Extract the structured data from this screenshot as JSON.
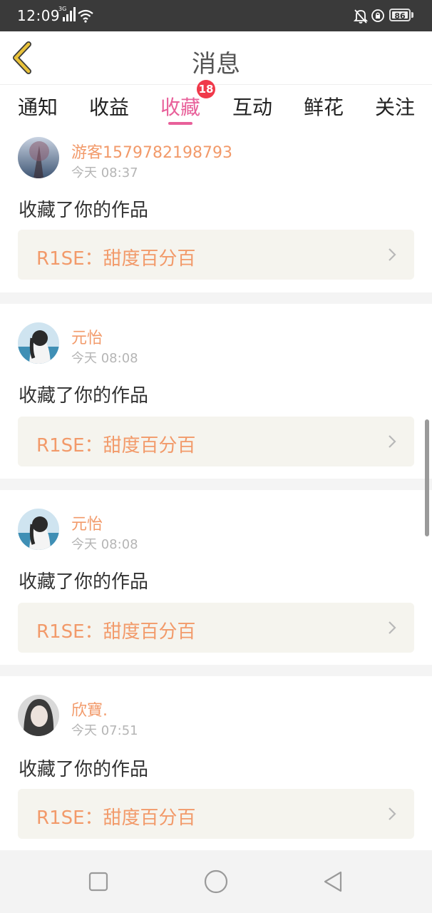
{
  "status_bar": {
    "time": "12:09",
    "network": "3G",
    "battery": "86"
  },
  "header": {
    "title": "消息"
  },
  "tabs": {
    "items": [
      {
        "label": "通知"
      },
      {
        "label": "收益"
      },
      {
        "label": "收藏"
      },
      {
        "label": "互动"
      },
      {
        "label": "鲜花"
      },
      {
        "label": "关注"
      }
    ],
    "active_index": 2,
    "badge": "18"
  },
  "messages": [
    {
      "username": "游客1579782198793",
      "time": "今天 08:37",
      "action": "收藏了你的作品",
      "work_title": "R1SE：甜度百分百"
    },
    {
      "username": "元怡",
      "time": "今天 08:08",
      "action": "收藏了你的作品",
      "work_title": "R1SE：甜度百分百"
    },
    {
      "username": "元怡",
      "time": "今天 08:08",
      "action": "收藏了你的作品",
      "work_title": "R1SE：甜度百分百"
    },
    {
      "username": "欣寶.",
      "time": "今天 07:51",
      "action": "收藏了你的作品",
      "work_title": "R1SE：甜度百分百"
    }
  ],
  "colors": {
    "accent": "#e8609a",
    "username": "#f29a6a",
    "badge": "#f0394a",
    "back_icon": "#e9c23a"
  },
  "icons": {
    "back": "chevron-left-icon",
    "work_arrow": "chevron-right-icon",
    "nav": [
      "square-icon",
      "circle-icon",
      "triangle-back-icon"
    ]
  }
}
